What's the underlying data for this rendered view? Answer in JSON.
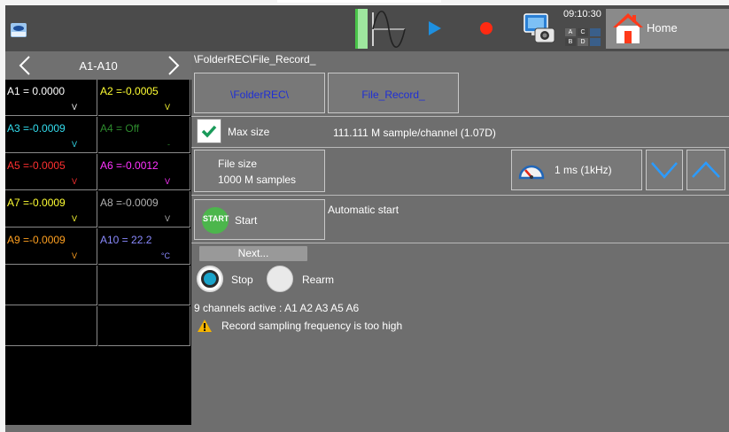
{
  "topbar": {
    "time": "09:10:30",
    "mini": [
      "A",
      "C",
      "B",
      "D"
    ],
    "home_label": "Home"
  },
  "nav": {
    "title": "A1-A10"
  },
  "channels": [
    {
      "text": "A1 = 0.0000",
      "unit": "V",
      "color": "#ffffff"
    },
    {
      "text": "A2 =-0.0005",
      "unit": "V",
      "color": "#ffff33"
    },
    {
      "text": "A3 =-0.0009",
      "unit": "V",
      "color": "#33ddee"
    },
    {
      "text": "A4 = Off",
      "unit": "-",
      "color": "#2d8a2d"
    },
    {
      "text": "A5 =-0.0005",
      "unit": "V",
      "color": "#ff3030"
    },
    {
      "text": "A6 =-0.0012",
      "unit": "V",
      "color": "#ff33ff"
    },
    {
      "text": "A7 =-0.0009",
      "unit": "V",
      "color": "#ffff33"
    },
    {
      "text": "A8 =-0.0009",
      "unit": "V",
      "color": "#b0b0b0"
    },
    {
      "text": "A9 =-0.0009",
      "unit": "V",
      "color": "#ffa020"
    },
    {
      "text": "A10 =  22.2",
      "unit": "°C",
      "color": "#8a8aff"
    }
  ],
  "main": {
    "path": "\\FolderREC\\File_Record_",
    "folder_btn": "\\FolderREC\\",
    "file_btn": "File_Record_",
    "max_size_label": "Max size",
    "max_size_info": "111.111 M sample/channel  (1.07D)",
    "file_size_line1": "File size",
    "file_size_line2": "1000 M samples",
    "rate_label": "1 ms (1kHz)",
    "start_badge": "START",
    "start_label": "Start",
    "auto_start": "Automatic start",
    "next_label": "Next...",
    "stop_label": "Stop",
    "rearm_label": "Rearm",
    "channels_active": "9 channels active : A1 A2 A3 A5 A6",
    "warning": "Record sampling frequency is too high"
  }
}
